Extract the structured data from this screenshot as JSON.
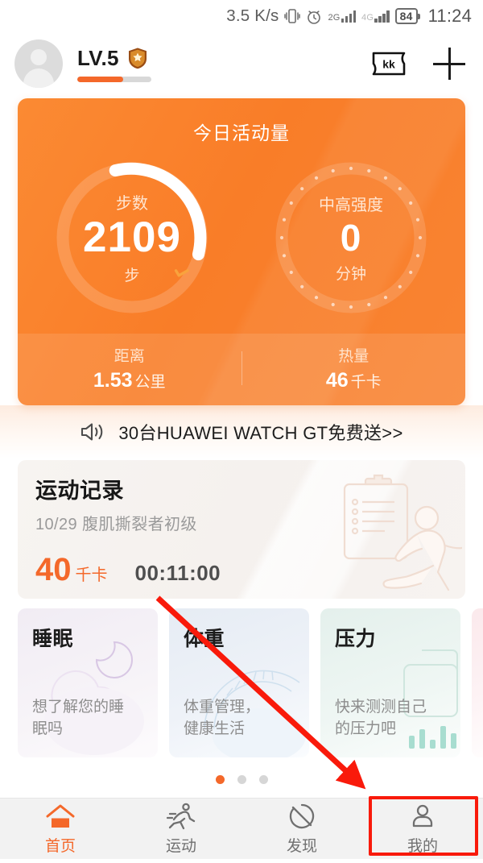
{
  "status_bar": {
    "net_speed": "3.5 K/s",
    "vibrate_icon": "vibrate-icon",
    "alarm_icon": "alarm-icon",
    "sim1_label": "2G",
    "sim2_label": "4G",
    "battery": "84",
    "time": "11:24"
  },
  "header": {
    "avatar": "user-avatar",
    "level": "LV.5",
    "badge_icon": "shield-star-badge-icon",
    "level_progress_pct": 62,
    "ticket_label": "kk",
    "ticket_icon": "ticket-kk-icon",
    "add_icon": "plus-icon"
  },
  "activity": {
    "title": "今日活动量",
    "steps": {
      "label": "步数",
      "value": "2109",
      "unit": "步",
      "progress_pct": 31,
      "check_icon": "check-icon"
    },
    "intensity": {
      "label": "中高强度",
      "value": "0",
      "unit": "分钟",
      "progress_pct": 0
    },
    "distance": {
      "label": "距离",
      "value": "1.53",
      "unit": "公里"
    },
    "calories": {
      "label": "热量",
      "value": "46",
      "unit": "千卡"
    }
  },
  "banner": {
    "speaker_icon": "speaker-icon",
    "text": "30台HUAWEI  WATCH GT免费送>>"
  },
  "record": {
    "title": "运动记录",
    "subtitle": "10/29  腹肌撕裂者初级",
    "calories": "40",
    "calories_unit": "千卡",
    "duration": "00:11:00",
    "art_icon": "clipboard-runner-illustration"
  },
  "mini_cards": [
    {
      "title": "睡眠",
      "desc": "想了解您的睡\n眠吗",
      "art": "moon-cloud-illustration"
    },
    {
      "title": "体重",
      "desc": "体重管理，\n健康生活",
      "art": "scale-dial-illustration"
    },
    {
      "title": "压力",
      "desc": "快来测测自己\n的压力吧",
      "art": "stress-bars-illustration"
    },
    {
      "title": "",
      "desc": "",
      "art": "partial-card"
    }
  ],
  "pager": {
    "total": 3,
    "active_index": 0
  },
  "partial_section": {
    "title": "步数"
  },
  "bottom_nav": {
    "items": [
      {
        "label": "首页",
        "icon": "home-icon",
        "active": true
      },
      {
        "label": "运动",
        "icon": "running-icon",
        "active": false
      },
      {
        "label": "发现",
        "icon": "discover-icon",
        "active": false
      },
      {
        "label": "我的",
        "icon": "person-icon",
        "active": false
      }
    ]
  },
  "annotations": {
    "arrow_color": "#f91a0b",
    "highlight_color": "#f91a0b",
    "highlight_target": "我的"
  },
  "colors": {
    "brand_orange": "#f4682a",
    "card_orange": "#f97d28",
    "nav_bg": "#f2f2f2",
    "muted_text": "#8d8d8d"
  }
}
